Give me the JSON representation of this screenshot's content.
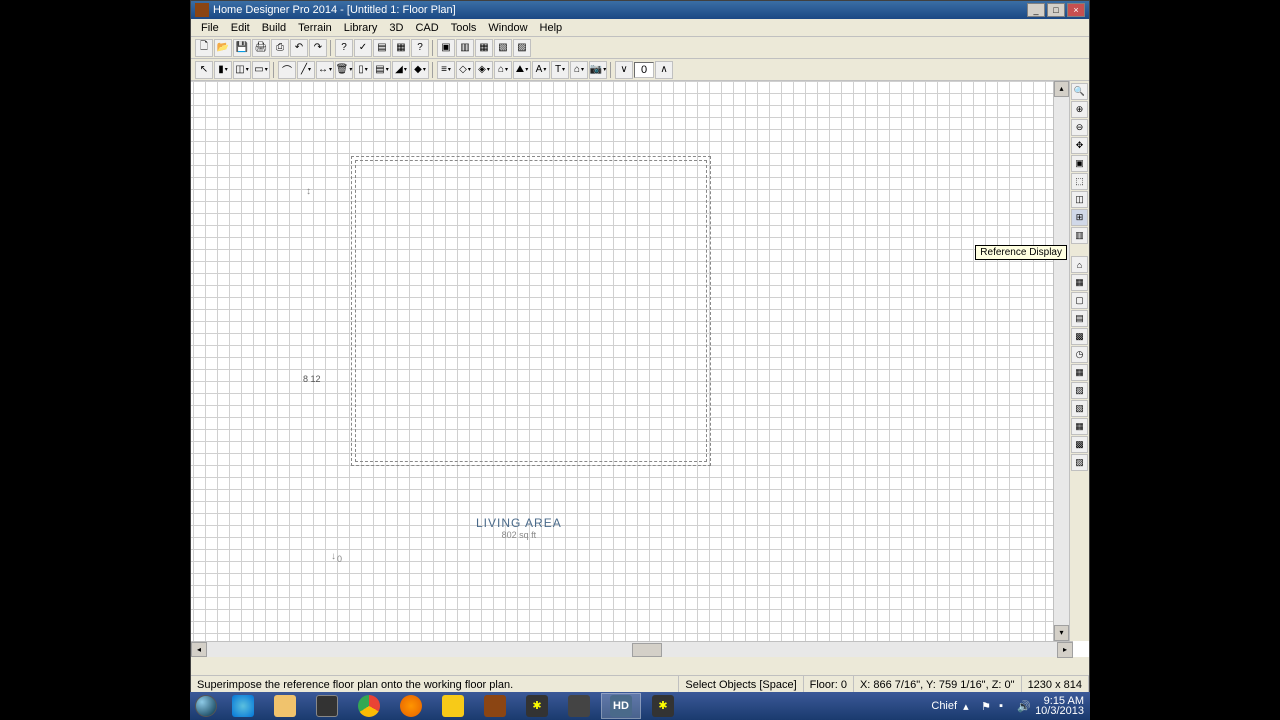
{
  "window": {
    "title": "Home Designer Pro 2014 - [Untitled 1: Floor Plan]",
    "min": "_",
    "max": "□",
    "close": "×"
  },
  "menu": [
    "File",
    "Edit",
    "Build",
    "Terrain",
    "Library",
    "3D",
    "CAD",
    "Tools",
    "Window",
    "Help"
  ],
  "toolbar2_number": "0",
  "tooltip": "Reference Display",
  "room": {
    "label": "LIVING AREA",
    "area": "802 sq ft",
    "dim_left": "8  12",
    "dim_bottom": "0"
  },
  "status": {
    "hint": "Superimpose the reference floor plan onto the working floor plan.",
    "mode": "Select Objects [Space]",
    "floor": "Floor: 0",
    "coords": "X: 866 7/16\", Y: 759 1/16\", Z: 0\"",
    "dims": "1230 x 814"
  },
  "taskbar": {
    "user": "Chief",
    "time": "9:15 AM",
    "date": "10/3/2013"
  },
  "icons": {
    "new": "🗋",
    "open": "📂",
    "save": "💾",
    "print": "🖨",
    "copy": "⎘",
    "undo": "↶",
    "redo": "↷",
    "help": "?",
    "check": "✓",
    "camera": "📷",
    "text": "T",
    "arrow": "↖",
    "house": "⌂",
    "zoom": "🔍",
    "zoomin": "⊕",
    "zoomout": "⊖",
    "fill": "▦"
  }
}
